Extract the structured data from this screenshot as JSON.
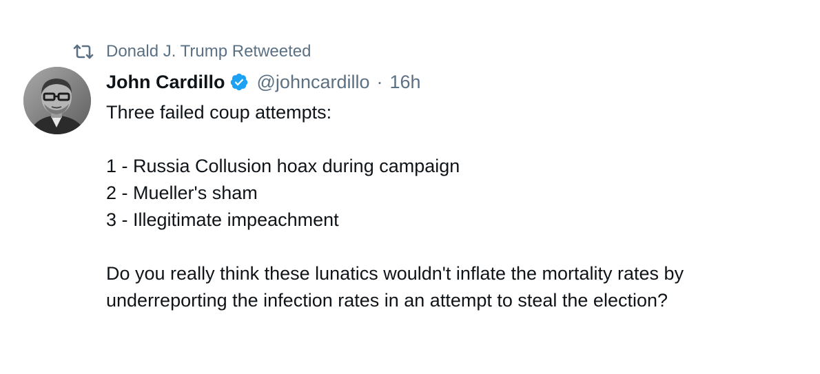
{
  "retweet": {
    "icon": "retweet-icon",
    "text": "Donald J. Trump Retweeted"
  },
  "author": {
    "display_name": "John Cardillo",
    "verified_icon": "verified-badge-icon",
    "handle": "@johncardillo",
    "separator": "·",
    "time": "16h"
  },
  "tweet": {
    "lines": [
      "Three failed coup attempts:",
      "",
      "1 - Russia Collusion hoax during campaign",
      "2 - Mueller's sham",
      "3 - Illegitimate impeachment",
      "",
      "Do you really think these lunatics wouldn't inflate the mortality rates by",
      "underreporting the infection rates in an attempt to steal the election?"
    ]
  },
  "colors": {
    "secondary_text": "#5b7083",
    "primary_text": "#0f1419",
    "verified_blue": "#1da1f2"
  }
}
